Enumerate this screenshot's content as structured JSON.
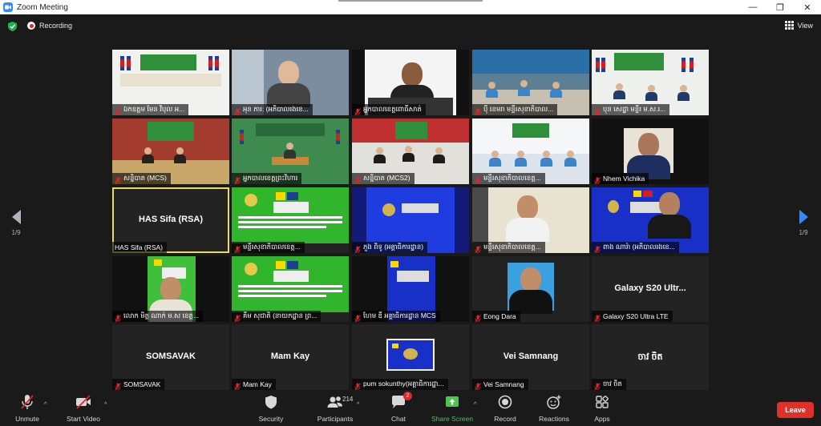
{
  "window": {
    "title": "Zoom Meeting",
    "minimize": "—",
    "maximize": "❐",
    "close": "✕"
  },
  "status": {
    "recording_label": "Recording",
    "view_label": "View"
  },
  "pagination": {
    "left_page": "1/9",
    "right_page": "1/9"
  },
  "tiles": [
    {
      "name": "ឯកឧត្តម មែន វិបុល អ...",
      "big_name": ""
    },
    {
      "name": "អុន ភារ: (អភិបាលរងខេ...",
      "big_name": ""
    },
    {
      "name": "អ្នកបាលខេត្តពោធិ៍សាត់",
      "big_name": ""
    },
    {
      "name": "បុី ខេមរា មន្ទីរសុខាភិបាល...",
      "big_name": ""
    },
    {
      "name": "បុន សេដ្ឋា មន្ទីរ ម.ស.រ...",
      "big_name": ""
    },
    {
      "name": "សន្និបាត (MCS)",
      "big_name": ""
    },
    {
      "name": "អ្នកបាលខេត្តព្រះវិហារ",
      "big_name": ""
    },
    {
      "name": "សន្និបាត (MCS2)",
      "big_name": ""
    },
    {
      "name": "មន្ទីរសុខាភិបាលខេត្ត...",
      "big_name": ""
    },
    {
      "name": "Nhem Vichika",
      "big_name": ""
    },
    {
      "name": "HAS Sifa (RSA)",
      "big_name": "HAS Sifa (RSA)"
    },
    {
      "name": "មន្ទីរសុខាភិបាលខេត្ត...",
      "big_name": ""
    },
    {
      "name": "ភួង ពិទូ (អគ្គាធិការដ្ឋាន)",
      "big_name": ""
    },
    {
      "name": "មន្ទីរសុខាភិបាលខេត្ត...",
      "big_name": ""
    },
    {
      "name": "ពាង ណារ៉ា (អភិបាលរងខេ...",
      "big_name": ""
    },
    {
      "name": "លោក មិត្ត ណាក់ ម.ស ខេត្ត...",
      "big_name": ""
    },
    {
      "name": "គឹម សុជាតិ (នាយកដ្ឋាន ព្រ...",
      "big_name": ""
    },
    {
      "name": "ហែម ឌី អគ្គាធិការដ្ឋាន MCS",
      "big_name": ""
    },
    {
      "name": "Eong Dara",
      "big_name": ""
    },
    {
      "name": "Galaxy S20 Ultra LTE",
      "big_name": "Galaxy S20 Ultr..."
    },
    {
      "name": "SOMSAVAK",
      "big_name": "SOMSAVAK"
    },
    {
      "name": "Mam Kay",
      "big_name": "Mam Kay"
    },
    {
      "name": "pum sokunthy(អគ្គាធិការដ្ឋា...",
      "big_name": ""
    },
    {
      "name": "Vei Samnang",
      "big_name": "Vei Samnang"
    },
    {
      "name": "ចាវ ចិត",
      "big_name": "ចាវ ចិត"
    }
  ],
  "toolbar": {
    "unmute": "Unmute",
    "start_video": "Start Video",
    "security": "Security",
    "participants": "Participants",
    "participant_count": "214",
    "chat": "Chat",
    "chat_badge": "2",
    "share_screen": "Share Screen",
    "record": "Record",
    "reactions": "Reactions",
    "apps": "Apps",
    "leave": "Leave"
  },
  "colors": {
    "accent": "#2d8cff",
    "share_green": "#4cc552",
    "leave_red": "#e0302a",
    "active_speaker": "#ecd96b"
  }
}
